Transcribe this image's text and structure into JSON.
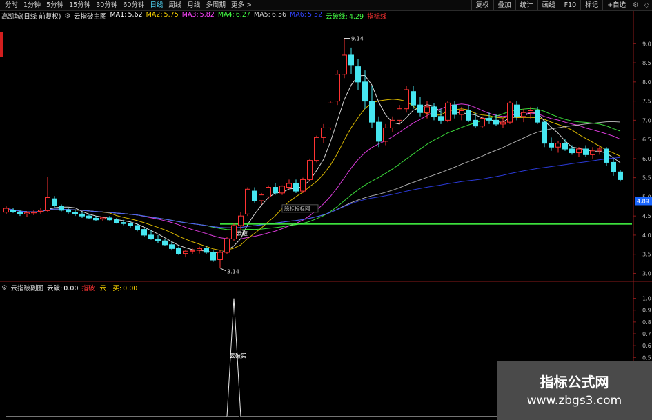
{
  "toolbar": {
    "periods": [
      "分时",
      "1分钟",
      "5分钟",
      "15分钟",
      "30分钟",
      "60分钟",
      "日线",
      "周线",
      "月线",
      "多周期",
      "更多 >"
    ],
    "active_period": "日线",
    "tools": [
      "复权",
      "叠加",
      "统计",
      "画线",
      "F10",
      "标记",
      "+自选"
    ],
    "tool_icons": [
      "settings-icon",
      "minimize-icon"
    ]
  },
  "main_legend": {
    "stock": "高凯城(日线 前复权)",
    "indicator": "云指破主图",
    "items": [
      {
        "label": "MA1:",
        "value": "5.62",
        "color": "#ffffff"
      },
      {
        "label": "MA2:",
        "value": "5.75",
        "color": "#ffd700"
      },
      {
        "label": "MA3:",
        "value": "5.82",
        "color": "#ff44ff"
      },
      {
        "label": "MA4:",
        "value": "6.27",
        "color": "#44ff44"
      },
      {
        "label": "MA5:",
        "value": "6.56",
        "color": "#cccccc"
      },
      {
        "label": "MA6:",
        "value": "5.52",
        "color": "#3344ff"
      },
      {
        "label": "云破线:",
        "value": "4.29",
        "color": "#44ff44"
      },
      {
        "label": "指标线",
        "value": "",
        "color": "#ff3333"
      }
    ]
  },
  "sub_legend": {
    "indicator": "云指破副图",
    "items": [
      {
        "label": "云破:",
        "value": "0.00",
        "color": "#ffffff"
      },
      {
        "label": "指破",
        "value": "",
        "color": "#ff3333"
      },
      {
        "label": "云二买:",
        "value": "0.00",
        "color": "#ffd700"
      }
    ]
  },
  "chart_data": [
    {
      "type": "candlestick",
      "title": "云指破主图",
      "ylim": [
        2.9,
        9.6
      ],
      "y_ticks": [
        "9.0",
        "8.5",
        "8.0",
        "7.5",
        "7.0",
        "6.5",
        "6.0",
        "5.5",
        "5.0",
        "4.5",
        "4.0",
        "3.5",
        "3.0"
      ],
      "last_price": "4.89",
      "high_label": "9.14",
      "low_label": "3.14",
      "annotations": [
        "云破",
        "股标指标网"
      ],
      "support_line": 4.29,
      "up_color": "#ff3333",
      "down_color": "#46e6f0",
      "candles": [
        [
          4.6,
          4.75,
          4.55,
          4.7
        ],
        [
          4.65,
          4.7,
          4.58,
          4.62
        ],
        [
          4.6,
          4.65,
          4.5,
          4.55
        ],
        [
          4.55,
          4.62,
          4.48,
          4.58
        ],
        [
          4.58,
          4.66,
          4.52,
          4.6
        ],
        [
          4.62,
          4.7,
          4.56,
          4.65
        ],
        [
          4.64,
          5.52,
          4.6,
          4.98
        ],
        [
          4.95,
          5.02,
          4.7,
          4.78
        ],
        [
          4.75,
          4.8,
          4.62,
          4.65
        ],
        [
          4.66,
          4.72,
          4.56,
          4.6
        ],
        [
          4.6,
          4.65,
          4.5,
          4.55
        ],
        [
          4.55,
          4.6,
          4.45,
          4.5
        ],
        [
          4.5,
          4.55,
          4.42,
          4.45
        ],
        [
          4.44,
          4.5,
          4.36,
          4.4
        ],
        [
          4.42,
          4.48,
          4.36,
          4.45
        ],
        [
          4.45,
          4.5,
          4.38,
          4.4
        ],
        [
          4.4,
          4.45,
          4.3,
          4.33
        ],
        [
          4.33,
          4.4,
          4.26,
          4.3
        ],
        [
          4.3,
          4.36,
          4.2,
          4.25
        ],
        [
          4.25,
          4.3,
          4.1,
          4.15
        ],
        [
          4.15,
          4.2,
          3.95,
          4.0
        ],
        [
          4.0,
          4.12,
          3.88,
          3.9
        ],
        [
          3.9,
          4.0,
          3.8,
          3.85
        ],
        [
          3.85,
          3.9,
          3.72,
          3.75
        ],
        [
          3.75,
          3.82,
          3.6,
          3.65
        ],
        [
          3.65,
          3.7,
          3.48,
          3.52
        ],
        [
          3.52,
          3.62,
          3.42,
          3.58
        ],
        [
          3.58,
          3.65,
          3.5,
          3.6
        ],
        [
          3.6,
          3.7,
          3.52,
          3.65
        ],
        [
          3.65,
          3.72,
          3.5,
          3.55
        ],
        [
          3.55,
          3.6,
          3.3,
          3.35
        ],
        [
          3.36,
          3.6,
          3.14,
          3.55
        ],
        [
          3.55,
          3.95,
          3.5,
          3.9
        ],
        [
          3.9,
          4.3,
          3.85,
          4.25
        ],
        [
          4.25,
          4.6,
          4.15,
          4.5
        ],
        [
          4.55,
          5.25,
          4.5,
          5.2
        ],
        [
          5.15,
          5.25,
          4.85,
          4.9
        ],
        [
          4.9,
          5.1,
          4.8,
          5.05
        ],
        [
          5.0,
          5.3,
          4.95,
          5.25
        ],
        [
          5.25,
          5.35,
          5.05,
          5.1
        ],
        [
          5.1,
          5.3,
          5.05,
          5.28
        ],
        [
          5.25,
          5.45,
          5.2,
          5.35
        ],
        [
          5.35,
          5.45,
          5.1,
          5.15
        ],
        [
          5.15,
          5.5,
          5.1,
          5.45
        ],
        [
          5.45,
          6.0,
          5.4,
          5.95
        ],
        [
          5.95,
          6.6,
          5.9,
          6.55
        ],
        [
          6.55,
          6.9,
          6.4,
          6.8
        ],
        [
          6.8,
          7.5,
          6.75,
          7.45
        ],
        [
          7.5,
          8.3,
          7.4,
          8.2
        ],
        [
          8.2,
          9.14,
          8.1,
          8.7
        ],
        [
          8.7,
          8.9,
          8.2,
          8.45
        ],
        [
          8.4,
          8.6,
          7.8,
          8.0
        ],
        [
          8.0,
          8.3,
          7.3,
          7.5
        ],
        [
          7.5,
          7.9,
          6.8,
          6.95
        ],
        [
          6.95,
          7.1,
          6.3,
          6.45
        ],
        [
          6.45,
          6.9,
          6.35,
          6.8
        ],
        [
          6.8,
          7.1,
          6.7,
          7.0
        ],
        [
          7.0,
          7.4,
          6.9,
          7.3
        ],
        [
          7.3,
          7.9,
          7.2,
          7.8
        ],
        [
          7.75,
          7.9,
          7.3,
          7.4
        ],
        [
          7.4,
          7.6,
          7.1,
          7.2
        ],
        [
          7.2,
          7.5,
          7.05,
          7.35
        ],
        [
          7.35,
          7.45,
          7.0,
          7.1
        ],
        [
          7.1,
          7.3,
          6.9,
          7.0
        ],
        [
          7.0,
          7.5,
          6.95,
          7.45
        ],
        [
          7.4,
          7.5,
          7.05,
          7.15
        ],
        [
          7.15,
          7.35,
          7.0,
          7.25
        ],
        [
          7.25,
          7.4,
          6.95,
          7.0
        ],
        [
          7.0,
          7.2,
          6.8,
          6.85
        ],
        [
          6.85,
          7.1,
          6.8,
          7.05
        ],
        [
          7.05,
          7.2,
          6.9,
          7.0
        ],
        [
          7.0,
          7.15,
          6.85,
          6.9
        ],
        [
          6.9,
          7.05,
          6.8,
          6.95
        ],
        [
          6.95,
          7.5,
          6.9,
          7.45
        ],
        [
          7.4,
          7.5,
          7.0,
          7.1
        ],
        [
          7.1,
          7.3,
          6.95,
          7.2
        ],
        [
          7.2,
          7.35,
          7.05,
          7.25
        ],
        [
          7.25,
          7.35,
          6.9,
          6.95
        ],
        [
          6.95,
          7.0,
          6.3,
          6.4
        ],
        [
          6.4,
          6.55,
          6.2,
          6.3
        ],
        [
          6.3,
          6.45,
          6.15,
          6.4
        ],
        [
          6.4,
          6.5,
          6.2,
          6.25
        ],
        [
          6.25,
          6.35,
          6.1,
          6.15
        ],
        [
          6.15,
          6.3,
          6.05,
          6.25
        ],
        [
          6.25,
          6.35,
          6.05,
          6.1
        ],
        [
          6.1,
          6.3,
          6.0,
          6.2
        ],
        [
          6.2,
          6.35,
          6.1,
          6.25
        ],
        [
          6.25,
          6.3,
          5.8,
          5.9
        ],
        [
          5.9,
          6.0,
          5.55,
          5.65
        ],
        [
          5.65,
          5.7,
          5.4,
          5.45
        ]
      ]
    },
    {
      "type": "line",
      "title": "云指破副图",
      "ylim": [
        0,
        1.05
      ],
      "y_ticks": [
        "1.0",
        "0.9",
        "0.8",
        "0.7",
        "0.6",
        "0.5",
        "0.4",
        "0.3",
        "0.2",
        "0.1",
        "0.0"
      ],
      "annotation": "云破买",
      "series": [
        {
          "name": "云破",
          "values": [
            0,
            0,
            0,
            0,
            0,
            0,
            0,
            0,
            0,
            0,
            0,
            0,
            0,
            0,
            0,
            0,
            0,
            0,
            0,
            0,
            0,
            0,
            0,
            0,
            0,
            0,
            0,
            0,
            0,
            0,
            0,
            0,
            0,
            1,
            0,
            0,
            0,
            0,
            0,
            0,
            0,
            0,
            0,
            0,
            0,
            0,
            0,
            0,
            0,
            0,
            0,
            0,
            0,
            0,
            0,
            0,
            0,
            0,
            0,
            0,
            0,
            0,
            0,
            0,
            0,
            0,
            0,
            0,
            0,
            0,
            0,
            0,
            0,
            0,
            0,
            0,
            0,
            0,
            0,
            0,
            0,
            0,
            0,
            0,
            0,
            0,
            0,
            0,
            0,
            0
          ]
        }
      ]
    }
  ],
  "brand": {
    "name": "指标公式网",
    "url": "www.zbgs3.com"
  }
}
